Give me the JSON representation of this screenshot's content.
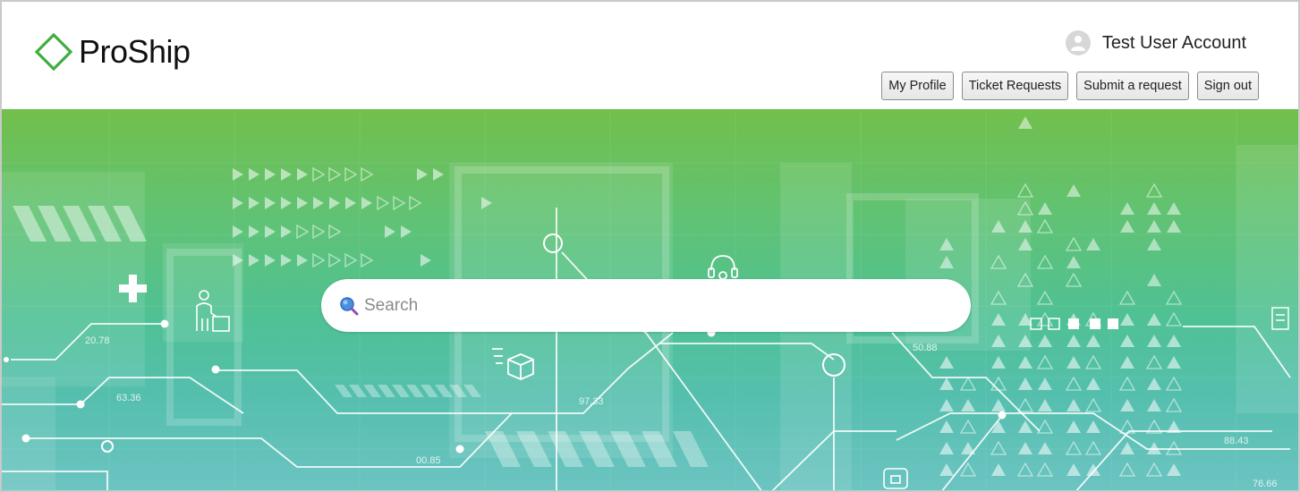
{
  "header": {
    "logo_text": "ProShip",
    "user_name": "Test User Account",
    "nav": [
      {
        "label": "My Profile"
      },
      {
        "label": "Ticket Requests"
      },
      {
        "label": "Submit a request"
      },
      {
        "label": "Sign out"
      }
    ]
  },
  "hero": {
    "search_placeholder": "Search",
    "background_numbers": [
      "20.78",
      "63.36",
      "00.85",
      "97.33",
      "50.88",
      "88.43",
      "76.66"
    ]
  },
  "colors": {
    "brand_green": "#3fae3f",
    "hero_top": "#72c04c",
    "hero_bottom": "#6cc4c2"
  },
  "icons": [
    "avatar-icon",
    "search-icon",
    "plus-icon",
    "headset-icon",
    "package-icon",
    "person-with-box-icon"
  ]
}
